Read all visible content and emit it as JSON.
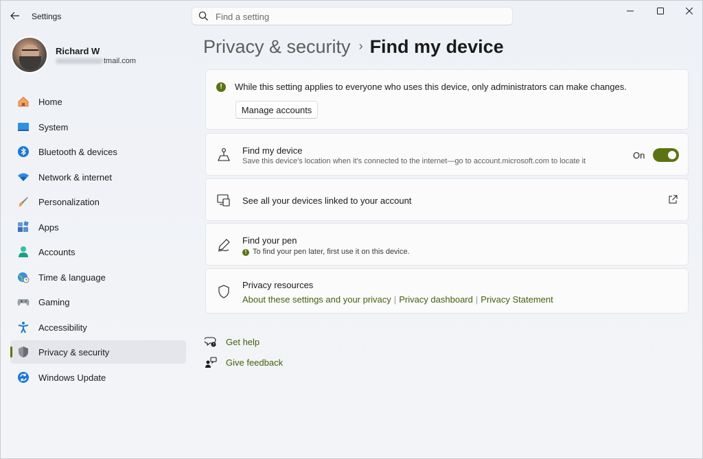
{
  "app": {
    "title": "Settings"
  },
  "search": {
    "placeholder": "Find a setting"
  },
  "user": {
    "name": "Richard W",
    "email_visible": "tmail.com"
  },
  "sidebar": {
    "items": [
      {
        "label": "Home",
        "icon": "home-icon"
      },
      {
        "label": "System",
        "icon": "monitor-icon"
      },
      {
        "label": "Bluetooth & devices",
        "icon": "bluetooth-icon"
      },
      {
        "label": "Network & internet",
        "icon": "wifi-icon"
      },
      {
        "label": "Personalization",
        "icon": "brush-icon"
      },
      {
        "label": "Apps",
        "icon": "apps-icon"
      },
      {
        "label": "Accounts",
        "icon": "person-icon"
      },
      {
        "label": "Time & language",
        "icon": "globe-clock-icon"
      },
      {
        "label": "Gaming",
        "icon": "controller-icon"
      },
      {
        "label": "Accessibility",
        "icon": "accessibility-icon"
      },
      {
        "label": "Privacy & security",
        "icon": "shield-icon",
        "active": true
      },
      {
        "label": "Windows Update",
        "icon": "update-icon"
      }
    ]
  },
  "breadcrumb": {
    "parent": "Privacy & security",
    "separator": "›",
    "current": "Find my device"
  },
  "info": {
    "text": "While this setting applies to everyone who uses this device, only administrators can make changes.",
    "button": "Manage accounts"
  },
  "find_my_device": {
    "title": "Find my device",
    "subtitle": "Save this device's location when it's connected to the internet—go to account.microsoft.com to locate it",
    "toggle_label": "On",
    "toggle_on": true
  },
  "devices": {
    "title": "See all your devices linked to your account"
  },
  "pen": {
    "title": "Find your pen",
    "note": "To find your pen later, first use it on this device."
  },
  "privacy_resources": {
    "title": "Privacy resources",
    "links": [
      "About these settings and your privacy",
      "Privacy dashboard",
      "Privacy Statement"
    ],
    "separator": "|"
  },
  "help": {
    "get_help": "Get help",
    "give_feedback": "Give feedback"
  },
  "colors": {
    "accent": "#5b7313",
    "link": "#44600a"
  }
}
